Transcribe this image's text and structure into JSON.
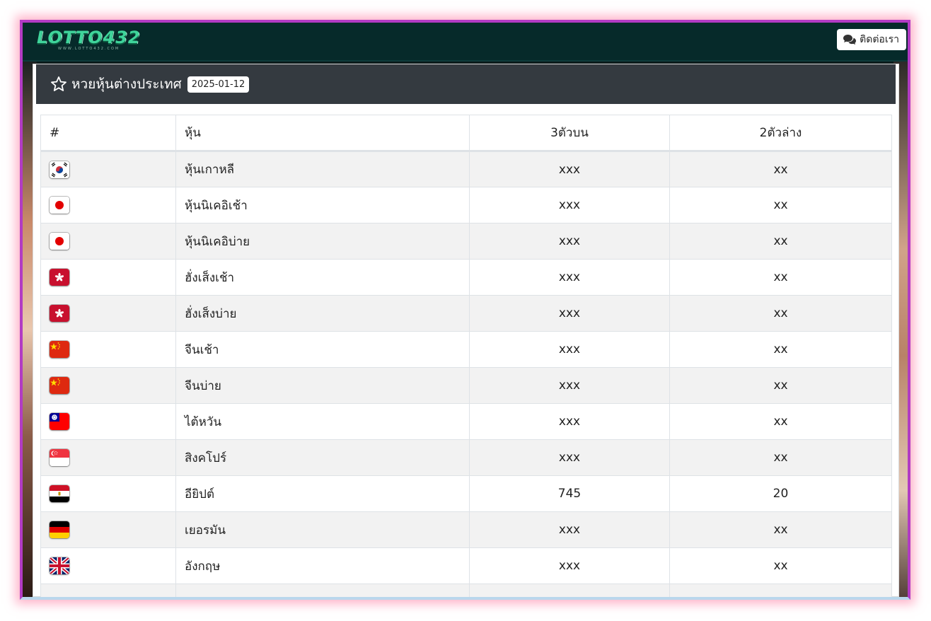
{
  "brand": {
    "logo_text": "LOTTO432",
    "logo_subtext": "WWW.LOTTO432.COM"
  },
  "navbar": {
    "contact_label": "ติดต่อเรา"
  },
  "panel": {
    "title": "หวยหุ้นต่างประเทศ",
    "date": "2025-01-12"
  },
  "table": {
    "headers": [
      "#",
      "หุ้น",
      "3ตัวบน",
      "2ตัวล่าง"
    ],
    "rows": [
      {
        "flag": "south-korea-flag-icon",
        "name": "หุ้นเกาหลี",
        "top3": "xxx",
        "bottom2": "xx"
      },
      {
        "flag": "japan-flag-icon",
        "name": "หุ้นนิเคอิเช้า",
        "top3": "xxx",
        "bottom2": "xx"
      },
      {
        "flag": "japan-flag-icon",
        "name": "หุ้นนิเคอิบ่าย",
        "top3": "xxx",
        "bottom2": "xx"
      },
      {
        "flag": "hong-kong-flag-icon",
        "name": "ฮั่งเส็งเช้า",
        "top3": "xxx",
        "bottom2": "xx"
      },
      {
        "flag": "hong-kong-flag-icon",
        "name": "ฮั่งเส็งบ่าย",
        "top3": "xxx",
        "bottom2": "xx"
      },
      {
        "flag": "china-flag-icon",
        "name": "จีนเช้า",
        "top3": "xxx",
        "bottom2": "xx"
      },
      {
        "flag": "china-flag-icon",
        "name": "จีนบ่าย",
        "top3": "xxx",
        "bottom2": "xx"
      },
      {
        "flag": "taiwan-flag-icon",
        "name": "ไต้หวัน",
        "top3": "xxx",
        "bottom2": "xx"
      },
      {
        "flag": "singapore-flag-icon",
        "name": "สิงคโปร์",
        "top3": "xxx",
        "bottom2": "xx"
      },
      {
        "flag": "egypt-flag-icon",
        "name": "อียิปต์",
        "top3": "745",
        "bottom2": "20"
      },
      {
        "flag": "germany-flag-icon",
        "name": "เยอรมัน",
        "top3": "xxx",
        "bottom2": "xx"
      },
      {
        "flag": "uk-flag-icon",
        "name": "อังกฤษ",
        "top3": "xxx",
        "bottom2": "xx"
      }
    ]
  },
  "colors": {
    "navbar": "#062a2a",
    "panel_header": "#343a40",
    "frame": "#b23bc4",
    "logo": "#3fd49b"
  }
}
